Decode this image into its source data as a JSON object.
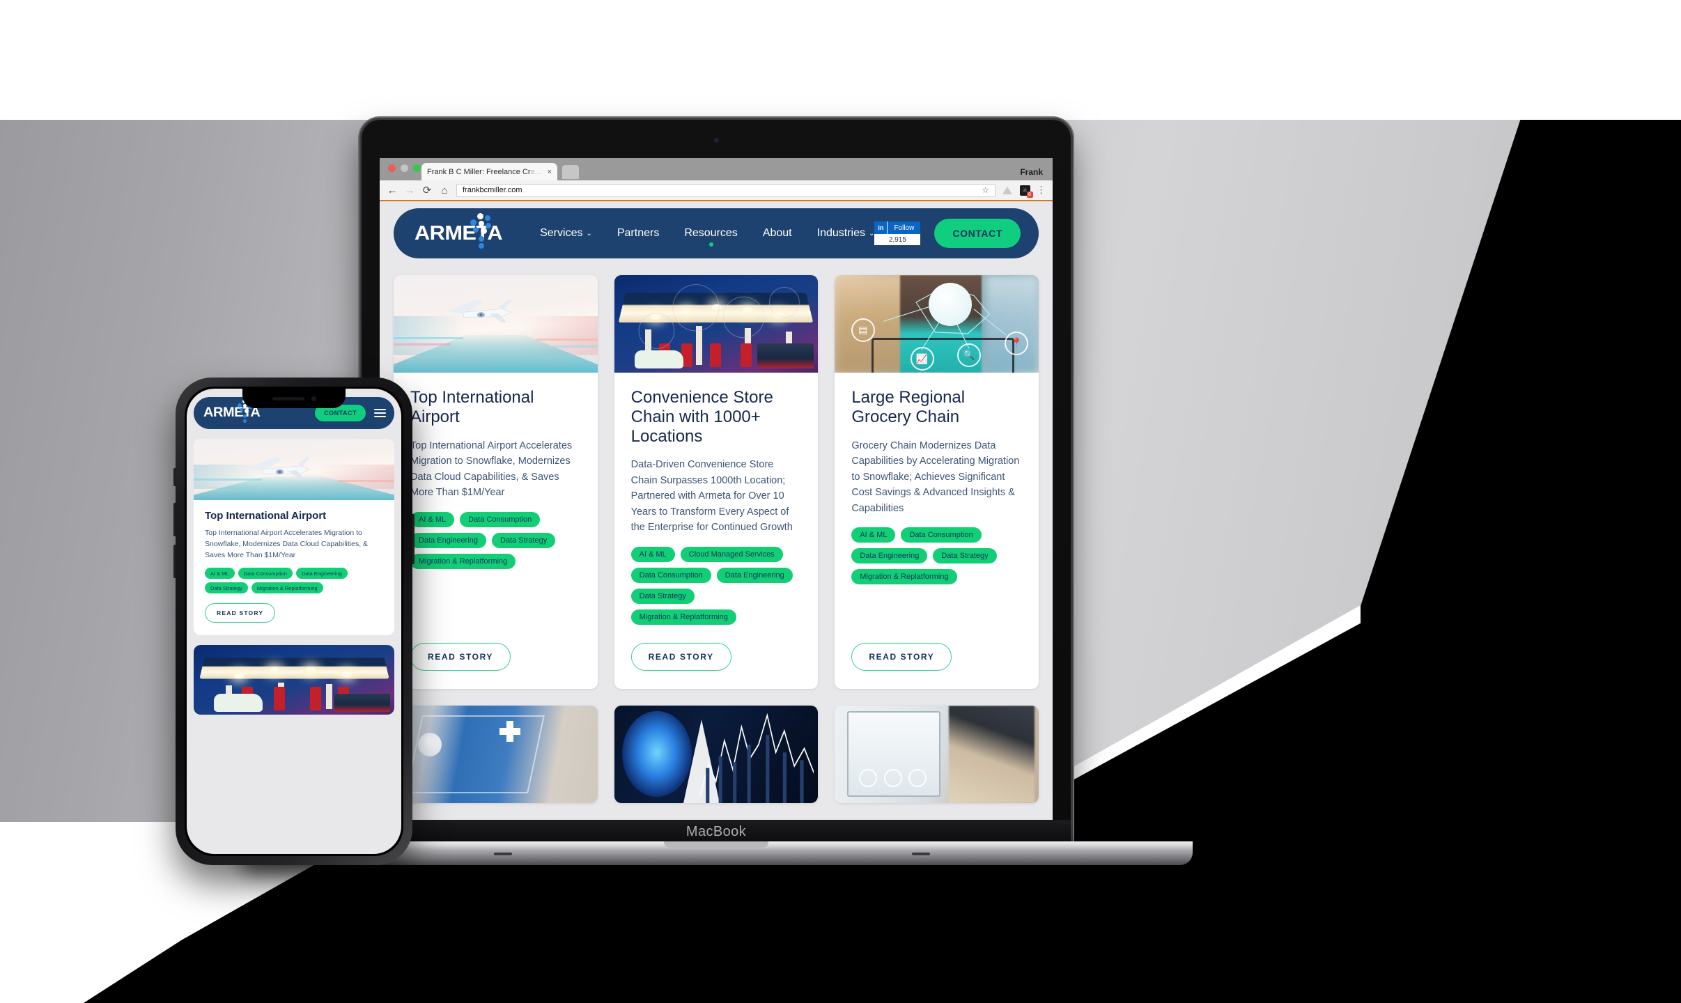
{
  "browser": {
    "profile_name": "Frank",
    "tab_title": "Frank B C Miller: Freelance Cr",
    "tab_title_faded": "e...",
    "tab_close": "×",
    "url": "frankbcmiller.com",
    "back_icon": "←",
    "forward_icon": "→",
    "reload_icon": "⟳",
    "home_icon": "⌂",
    "star_icon": "☆",
    "extension_badge": "8",
    "menu_icon": "⋮"
  },
  "device": {
    "laptop_label": "MacBook"
  },
  "site": {
    "logo_text": "ARMETA",
    "nav_links": [
      {
        "label": "Services",
        "caret": "⌄",
        "active": false
      },
      {
        "label": "Partners",
        "caret": "",
        "active": false
      },
      {
        "label": "Resources",
        "caret": "",
        "active": true
      },
      {
        "label": "About",
        "caret": "",
        "active": false
      },
      {
        "label": "Industries",
        "caret": "⌄",
        "active": false
      }
    ],
    "linkedin": {
      "icon_label": "in",
      "follow_label": "Follow",
      "follower_count": "2,915"
    },
    "contact_label": "CONTACT",
    "read_story_label": "READ STORY",
    "colors": {
      "nav_blue": "#1e4270",
      "accent_green": "#0fce7f",
      "tag_green": "#12cf76",
      "title_navy": "#15284e",
      "body_blue": "#3c5577"
    },
    "cards": [
      {
        "title": "Top International Airport",
        "description": "Top International Airport Accelerates Migration to Snowflake, Modernizes Data Cloud Capabilities, & Saves More Than $1M/Year",
        "tags": [
          "AI & ML",
          "Data Consumption",
          "Data Engineering",
          "Data Strategy",
          "Migration & Replatforming"
        ],
        "image_alt": "airplane-taking-off"
      },
      {
        "title": "Convenience Store Chain with 1000+ Locations",
        "description": "Data-Driven Convenience Store Chain Surpasses 1000th Location; Partnered with Armeta for Over 10 Years to Transform Every Aspect of the Enterprise for Continued Growth",
        "tags": [
          "AI & ML",
          "Cloud Managed Services",
          "Data Consumption",
          "Data Engineering",
          "Data Strategy",
          "Migration & Replatforming"
        ],
        "image_alt": "gas-station-at-dusk"
      },
      {
        "title": "Large Regional Grocery Chain",
        "description": "Grocery Chain Modernizes Data Capabilities by Accelerating Migration to Snowflake; Achieves Significant Cost Savings & Advanced Insights & Capabilities",
        "tags": [
          "AI & ML",
          "Data Consumption",
          "Data Engineering",
          "Data Strategy",
          "Migration & Replatforming"
        ],
        "image_alt": "grocery-shopper-with-network-overlay"
      }
    ],
    "cards_row2": [
      {
        "image_alt": "healthcare-data-icons"
      },
      {
        "image_alt": "gas-flame-with-stock-chart"
      },
      {
        "image_alt": "person-at-laptop"
      }
    ]
  },
  "mobile": {
    "logo_text": "ARMETA",
    "contact_label": "CONTACT",
    "menu_icon": "hamburger",
    "read_story_label": "READ STORY",
    "card": {
      "title": "Top International Airport",
      "description": "Top International Airport Accelerates Migration to Snowflake, Modernizes Data Cloud Capabilities, & Saves More Than $1M/Year",
      "tags": [
        "AI & ML",
        "Data Consumption",
        "Data Engineering",
        "Data Strategy",
        "Migration & Replatforming"
      ],
      "image_alt": "airplane-taking-off"
    },
    "card2": {
      "image_alt": "gas-station-at-dusk"
    }
  }
}
